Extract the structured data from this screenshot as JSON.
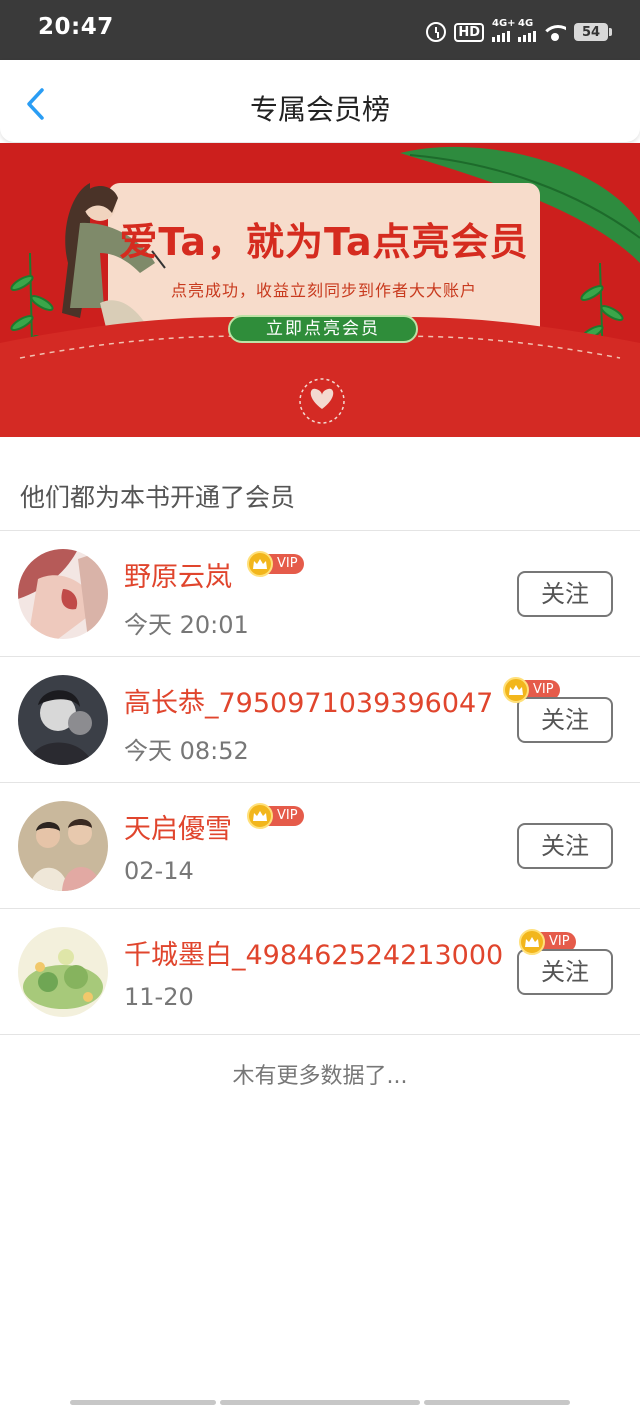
{
  "status_bar": {
    "time": "20:47",
    "hd_label": "HD",
    "sig1_label": "4G+",
    "sig2_label": "4G",
    "battery": "54"
  },
  "header": {
    "back_icon": "chevron-left-icon",
    "title": "专属会员榜"
  },
  "banner": {
    "headline": "爱Ta，就为Ta点亮会员",
    "subline": "点亮成功，收益立刻同步到作者大大账户",
    "cta_label": "立即点亮会员",
    "bg_color": "#cc1f1d"
  },
  "list": {
    "section_title": "他们都为本书开通了会员",
    "vip_label": "VIP",
    "follow_label": "关注",
    "members": [
      {
        "name": "野原云岚",
        "time": "今天 20:01"
      },
      {
        "name": "高长恭_7950971039396047",
        "time": "今天 08:52"
      },
      {
        "name": "天启優雪",
        "time": "02-14"
      },
      {
        "name": "千城墨白_498462524213000",
        "time": "11-20"
      }
    ],
    "footer": "木有更多数据了..."
  },
  "colors": {
    "accent_name": "#e0452d",
    "back_arrow": "#2a9df4",
    "vip_tag": "#e55b4a",
    "crown": "#f2b61c"
  }
}
